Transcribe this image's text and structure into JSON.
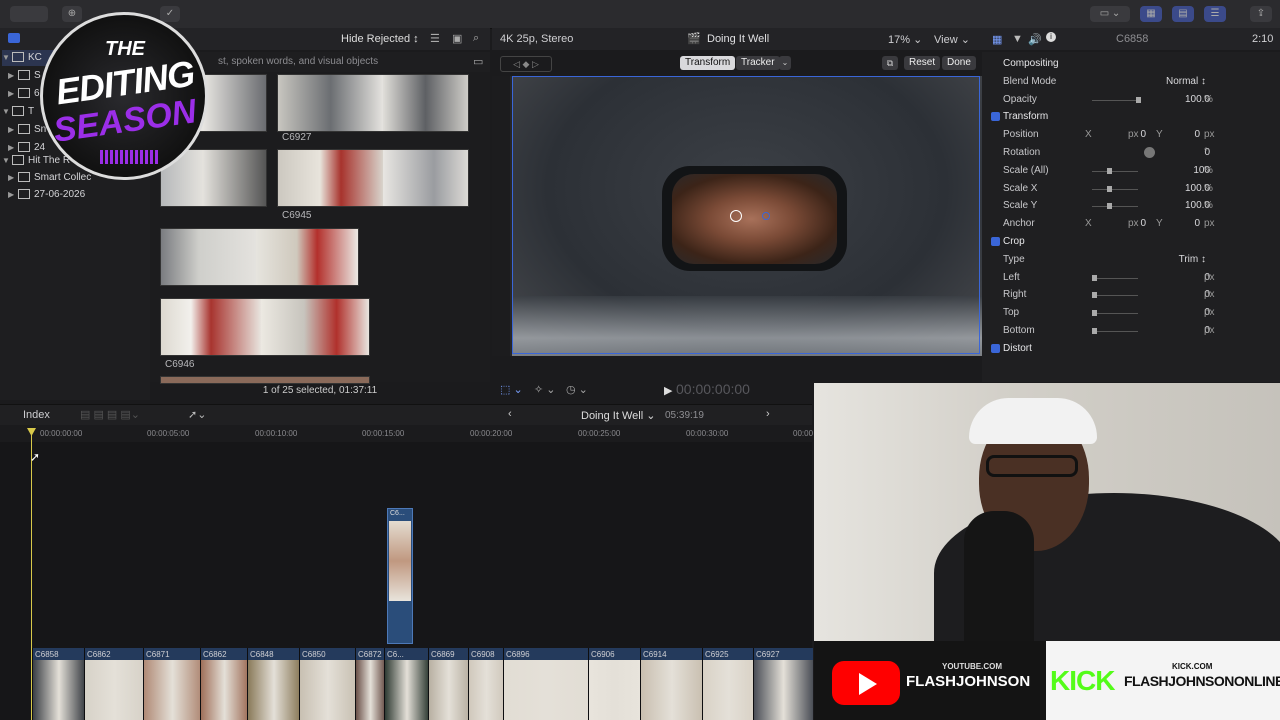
{
  "toolbar": {
    "buttons": [
      "",
      "",
      "",
      ""
    ]
  },
  "libraries": {
    "items": [
      {
        "label": "KC",
        "icon": "library-icon"
      },
      {
        "label": "S",
        "icon": "event-icon"
      },
      {
        "label": "6",
        "icon": "event-icon"
      },
      {
        "label": "T",
        "icon": "library-icon"
      },
      {
        "label": "Sn",
        "icon": "event-icon"
      },
      {
        "label": "24",
        "icon": "event-icon"
      },
      {
        "label": "Hit The R",
        "icon": "library-icon"
      },
      {
        "label": "Smart Collec",
        "icon": "folder-icon"
      },
      {
        "label": "27-06-2026",
        "icon": "event-icon"
      }
    ]
  },
  "browser": {
    "filter": "Hide Rejected",
    "search_placeholder": "st, spoken words, and visual objects",
    "clip_names": [
      "C6927",
      "C6945",
      "C6946"
    ],
    "status": "1 of 25 selected, 01:37:11"
  },
  "viewer": {
    "format": "4K 25p, Stereo",
    "project": "Doing It Well",
    "zoom": "17%",
    "view": "View",
    "transform_btn": "Transform",
    "tracker_btn": "Tracker",
    "reset_btn": "Reset",
    "done_btn": "Done",
    "timecode": "00:00:00:00"
  },
  "inspector": {
    "clip": "C6858",
    "duration": "2:10",
    "rows": [
      {
        "kind": "section",
        "label": "Compositing"
      },
      {
        "kind": "param",
        "label": "Blend Mode",
        "value": "Normal ↕"
      },
      {
        "kind": "param",
        "label": "Opacity",
        "value": "100.0",
        "unit": "%",
        "slider": 1.0
      },
      {
        "kind": "check",
        "label": "Transform"
      },
      {
        "kind": "xy",
        "label": "Position",
        "x": "0",
        "y": "0",
        "unit": "px"
      },
      {
        "kind": "param",
        "label": "Rotation",
        "value": "0",
        "unit": "°"
      },
      {
        "kind": "param",
        "label": "Scale (All)",
        "value": "100",
        "unit": "%",
        "slider": 0.33
      },
      {
        "kind": "param",
        "label": "Scale X",
        "value": "100.0",
        "unit": "%",
        "slider": 0.33
      },
      {
        "kind": "param",
        "label": "Scale Y",
        "value": "100.0",
        "unit": "%",
        "slider": 0.33
      },
      {
        "kind": "xy",
        "label": "Anchor",
        "x": "0",
        "y": "0",
        "unit": "px"
      },
      {
        "kind": "check",
        "label": "Crop"
      },
      {
        "kind": "param",
        "label": "Type",
        "value": "Trim ↕"
      },
      {
        "kind": "param",
        "label": "Left",
        "value": "0",
        "unit": "px",
        "slider": 0.0
      },
      {
        "kind": "param",
        "label": "Right",
        "value": "0",
        "unit": "px",
        "slider": 0.0
      },
      {
        "kind": "param",
        "label": "Top",
        "value": "0",
        "unit": "px",
        "slider": 0.0
      },
      {
        "kind": "param",
        "label": "Bottom",
        "value": "0",
        "unit": "px",
        "slider": 0.0
      },
      {
        "kind": "check",
        "label": "Distort"
      }
    ]
  },
  "timeline": {
    "index": "Index",
    "project": "Doing It Well",
    "duration": "05:39:19",
    "ruler": [
      "00:00:00:00",
      "00:00:05:00",
      "00:00:10:00",
      "00:00:15:00",
      "00:00:20:00",
      "00:00:25:00",
      "00:00:30:00",
      "00:00"
    ],
    "connected_clip": "C6...",
    "clips": [
      "C6858",
      "C6862",
      "C6871",
      "C6862",
      "C6848",
      "C6850",
      "C6872",
      "C6...",
      "C6869",
      "C6908",
      "C6896",
      "C6906",
      "C6914",
      "C6925",
      "C6927"
    ]
  },
  "overlay": {
    "logo_line1": "THE",
    "logo_line2": "EDITING",
    "logo_line3": "SEASON",
    "youtube_site": "YOUTUBE.COM",
    "youtube_name": "FLASHJOHNSON",
    "kick_logo": "KICK",
    "kick_site": "KICK.COM",
    "kick_name": "FLASHJOHNSONONLINE"
  },
  "colors": {
    "accent": "#3a66d8",
    "kick_green": "#53fc18",
    "youtube_red": "#ff0000",
    "logo_purple": "#9b2ee8"
  }
}
